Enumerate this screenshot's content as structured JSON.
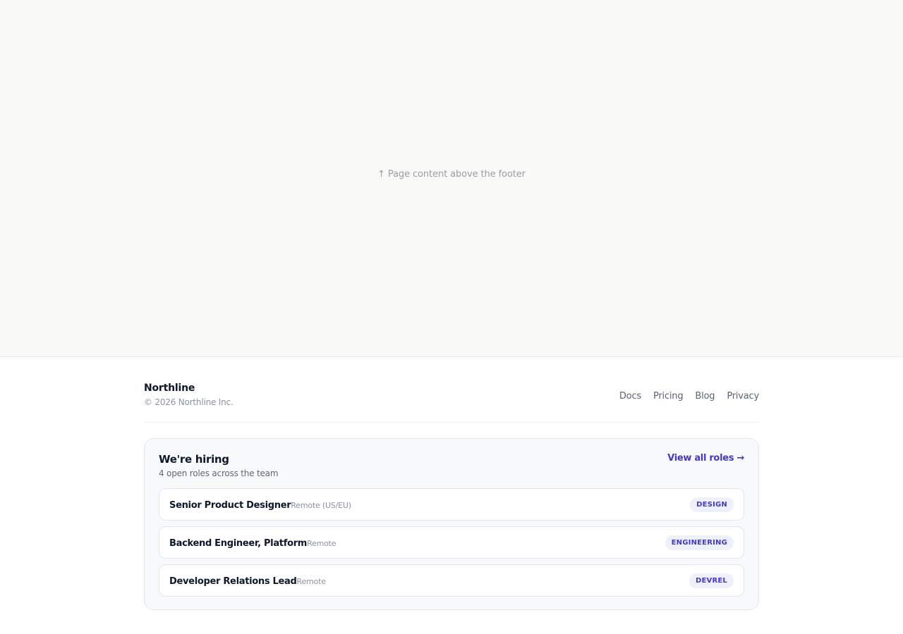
{
  "page": {
    "content_hint": "↑ Page content above the footer"
  },
  "footer": {
    "brand": "Northline",
    "copyright": "© 2026 Northline Inc.",
    "links": [
      {
        "label": "Docs"
      },
      {
        "label": "Pricing"
      },
      {
        "label": "Blog"
      },
      {
        "label": "Privacy"
      }
    ]
  },
  "hiring": {
    "title": "We're hiring",
    "subtitle": "4 open roles across the team",
    "view_all": "View all roles →",
    "roles": [
      {
        "title": "Senior Product Designer",
        "location": "Remote (US/EU)",
        "team": "DESIGN"
      },
      {
        "title": "Backend Engineer, Platform",
        "location": "Remote",
        "team": "ENGINEERING"
      },
      {
        "title": "Developer Relations Lead",
        "location": "Remote",
        "team": "DEVREL"
      }
    ]
  },
  "colors": {
    "accent": "#4338ca",
    "badge_bg": "#eef0fb",
    "text_primary": "#0f172a",
    "text_muted": "#8b93a1"
  }
}
